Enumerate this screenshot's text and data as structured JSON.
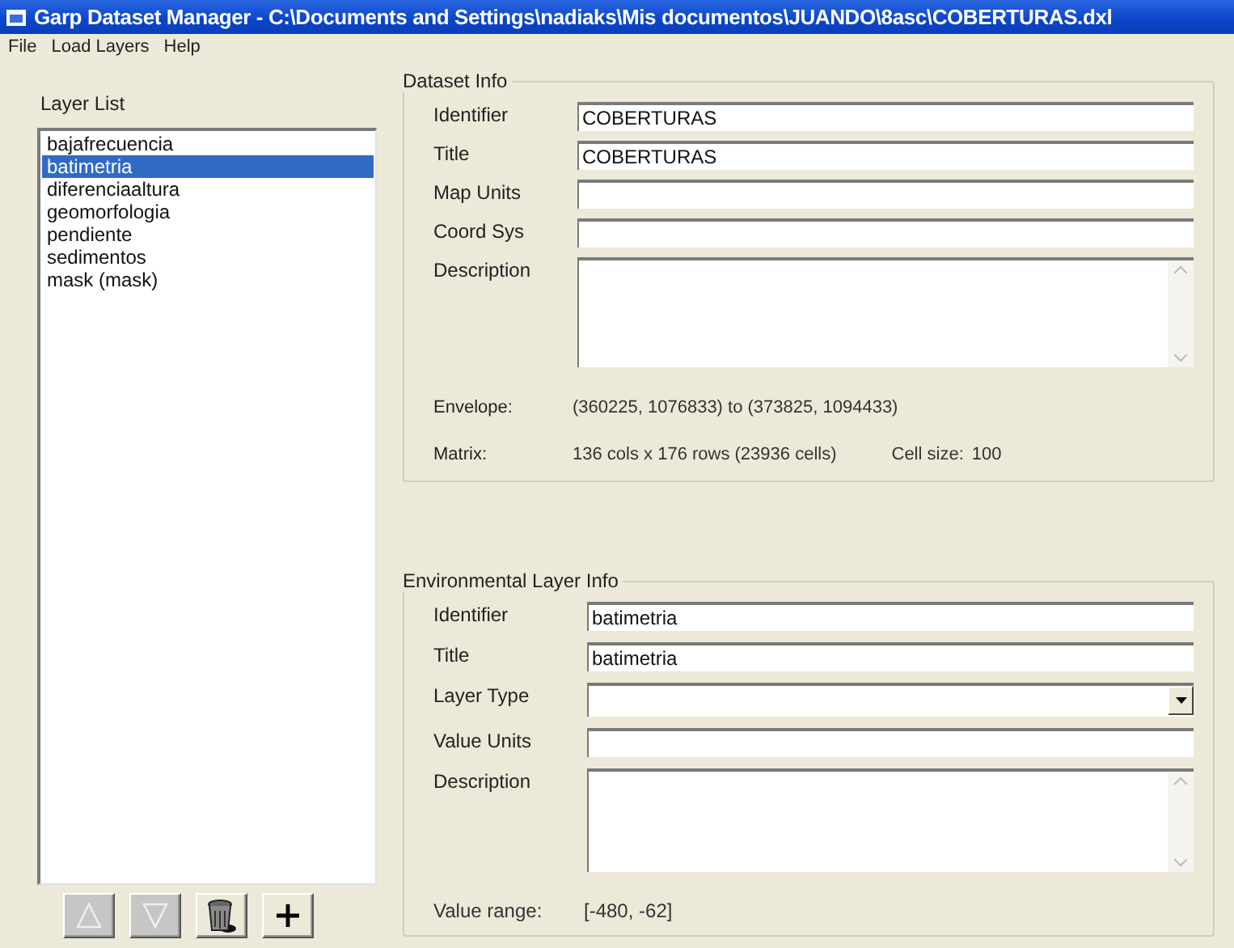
{
  "window": {
    "title": "Garp Dataset Manager - C:\\Documents and Settings\\nadiaks\\Mis documentos\\JUANDO\\8asc\\COBERTURAS.dxl"
  },
  "menu": [
    "File",
    "Load Layers",
    "Help"
  ],
  "layer_list": {
    "label": "Layer List",
    "items": [
      {
        "label": "bajafrecuencia",
        "selected": false
      },
      {
        "label": "batimetria",
        "selected": true
      },
      {
        "label": "diferenciaaltura",
        "selected": false
      },
      {
        "label": "geomorfologia",
        "selected": false
      },
      {
        "label": "pendiente",
        "selected": false
      },
      {
        "label": "sedimentos",
        "selected": false
      },
      {
        "label": "mask (mask)",
        "selected": false
      }
    ]
  },
  "list_buttons": [
    {
      "kind": "up"
    },
    {
      "kind": "down"
    },
    {
      "kind": "trash"
    },
    {
      "kind": "add"
    }
  ],
  "dataset_info": {
    "title": "Dataset Info",
    "fields": [
      {
        "label": "Identifier",
        "kind": "text",
        "value": "COBERTURAS"
      },
      {
        "label": "Title",
        "kind": "text",
        "value": "COBERTURAS"
      },
      {
        "label": "Map Units",
        "kind": "text"
      },
      {
        "label": "Coord Sys",
        "kind": "text"
      },
      {
        "label": "Description",
        "kind": "memo"
      }
    ],
    "envelope": {
      "label": "Envelope:",
      "value": "(360225, 1076833) to (373825, 1094433)"
    },
    "matrix": {
      "label": "Matrix:",
      "value": "136 cols x 176 rows (23936 cells)",
      "cell_size_label": "Cell size:",
      "cell_size": "100"
    }
  },
  "layer_info": {
    "title": "Environmental Layer Info",
    "fields": [
      {
        "label": "Identifier",
        "kind": "text",
        "value": "batimetria"
      },
      {
        "label": "Title",
        "kind": "text",
        "value": "batimetria"
      },
      {
        "label": "Layer Type",
        "kind": "select"
      },
      {
        "label": "Value Units",
        "kind": "text"
      },
      {
        "label": "Description",
        "kind": "memo"
      }
    ],
    "value_range": {
      "label": "Value range:",
      "value": "[-480, -62]"
    }
  }
}
